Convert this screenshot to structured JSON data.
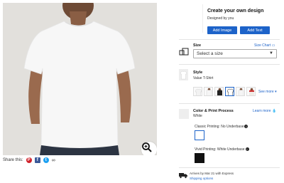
{
  "share": {
    "label": "Share this:"
  },
  "design": {
    "title": "Create your own design",
    "subtitle": "Designed by you",
    "add_image": "Add Image",
    "add_text": "Add Text"
  },
  "size": {
    "label": "Size",
    "chart_link": "Size Chart",
    "selected": "Select a size"
  },
  "style": {
    "label": "Style",
    "value": "Value T-Shirt",
    "more_link": "See more",
    "swatch_count_visible": 7,
    "selected_index": 3
  },
  "color": {
    "label": "Color & Print Process",
    "value": "White",
    "learn_more": "Learn more",
    "options": [
      {
        "label": "Classic Printing: No Underbase",
        "swatch": "#ffffff"
      },
      {
        "label": "Vivid Printing: White Underbase",
        "swatch": "#111111"
      }
    ]
  },
  "shipping": {
    "arrives": "Arrives by Mar 21 with Express",
    "options_link": "Shipping options"
  },
  "colors": {
    "accent": "#1d63c9",
    "image_bg": "#e2e0dc"
  }
}
